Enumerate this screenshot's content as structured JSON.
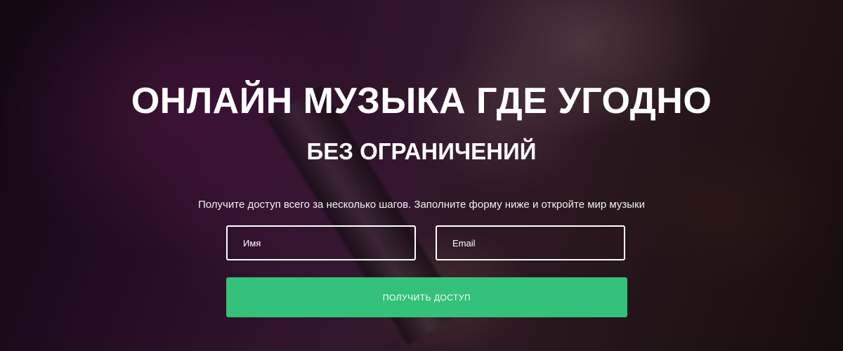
{
  "hero": {
    "title": "ОНЛАЙН МУЗЫКА ГДЕ УГОДНО",
    "subtitle": "БЕЗ ОГРАНИЧЕНИЙ",
    "lead": "Получите доступ всего за несколько шагов. Заполните форму ниже и откройте мир музыки"
  },
  "form": {
    "name_placeholder": "Имя",
    "email_placeholder": "Email",
    "submit_label": "ПОЛУЧИТЬ ДОСТУП"
  },
  "colors": {
    "accent": "#34c17a",
    "text": "#ffffff",
    "field_border": "#ffffff"
  }
}
